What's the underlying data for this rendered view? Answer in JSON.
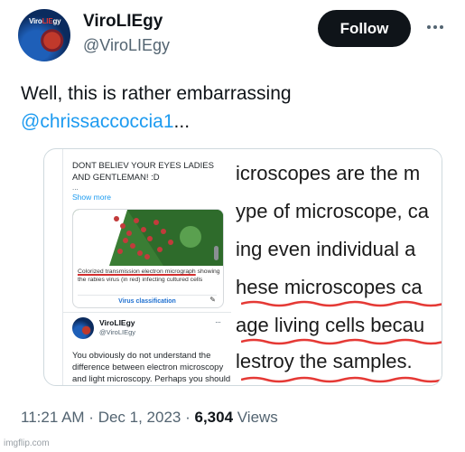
{
  "header": {
    "display_name": "ViroLIEgy",
    "handle": "@ViroLIEgy",
    "follow_label": "Follow",
    "avatar_text_a": "Viro",
    "avatar_text_b": "LIE",
    "avatar_text_c": "gy"
  },
  "tweet": {
    "text_line1": "Well, this is rather embarrassing",
    "mention": "@chrissaccoccia1",
    "mention_suffix": "..."
  },
  "media": {
    "left": {
      "quote_text": "DONT BELIEV YOUR EYES LADIES AND GENTLEMAN! :D",
      "ellipsis": "...",
      "show_more": "Show more",
      "caption_underlined": "Colorized transmission electron micrograph",
      "caption_rest": " showing the rabies virus (in red) infecting cultured cells",
      "virus_classification": "Virus classification",
      "reply_name": "ViroLIEgy",
      "reply_handle": "@ViroLIEgy",
      "reply_more": "···",
      "reply_text": "You obviously do not understand the difference between electron microscopy and light microscopy. Perhaps you should read"
    },
    "right": {
      "lines": [
        "icroscopes are the m",
        "ype of microscope, ca",
        "ing even individual a",
        "hese microscopes ca",
        "age living cells becau",
        "lestroy the samples."
      ],
      "underline_color": "#e53935"
    }
  },
  "footer": {
    "time": "11:21 AM",
    "sep1": " · ",
    "date": "Dec 1, 2023",
    "sep2": " · ",
    "views_count": "6,304",
    "views_label": " Views"
  },
  "watermark": "imgflip.com",
  "colors": {
    "link": "#1d9bf0",
    "text": "#0f1419",
    "secondary": "#536471",
    "button_bg": "#0f1419"
  }
}
